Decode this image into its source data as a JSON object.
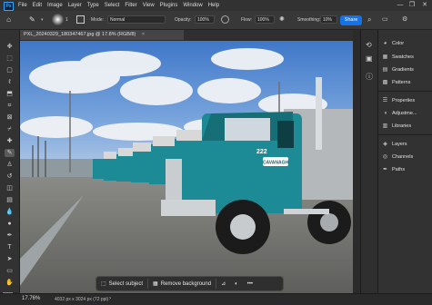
{
  "app": {
    "logo_text": "Ps"
  },
  "menu": [
    "File",
    "Edit",
    "Image",
    "Layer",
    "Type",
    "Select",
    "Filter",
    "View",
    "Plugins",
    "Window",
    "Help"
  ],
  "window_controls": [
    "—",
    "❐",
    "✕"
  ],
  "options_bar": {
    "mode_label": "Mode:",
    "mode_value": "Normal",
    "opacity_label": "Opacity:",
    "opacity_value": "100%",
    "flow_label": "Flow:",
    "flow_value": "100%",
    "smoothing_label": "Smoothing:",
    "smoothing_value": "10%",
    "brush_size": "1",
    "share_label": "Share"
  },
  "document": {
    "tab_title": "PXL_20240329_180347467.jpg @ 17.8% (RGB/8)",
    "tab_close": "×"
  },
  "status_bar": {
    "zoom": "17.76%",
    "doc_info": "4032 px x 3024 px (72 ppi)"
  },
  "context_bar": {
    "select_subject": "Select subject",
    "remove_background": "Remove background",
    "more": "•••"
  },
  "panels": [
    {
      "label": "Color",
      "icon": "color-wheel-icon"
    },
    {
      "label": "Swatches",
      "icon": "swatches-icon"
    },
    {
      "label": "Gradients",
      "icon": "gradients-icon"
    },
    {
      "label": "Patterns",
      "icon": "patterns-icon"
    },
    {
      "label": "Properties",
      "icon": "properties-icon"
    },
    {
      "label": "Adjustme...",
      "icon": "adjustments-icon"
    },
    {
      "label": "Libraries",
      "icon": "libraries-icon"
    },
    {
      "label": "Layers",
      "icon": "layers-icon"
    },
    {
      "label": "Channels",
      "icon": "channels-icon"
    },
    {
      "label": "Paths",
      "icon": "paths-icon"
    }
  ],
  "truck": {
    "number": "222",
    "brand": "CAVANAGH"
  },
  "colors": {
    "accent": "#1473e6",
    "truck_teal": "#1c8b95",
    "sky": "#5b8fd6"
  }
}
